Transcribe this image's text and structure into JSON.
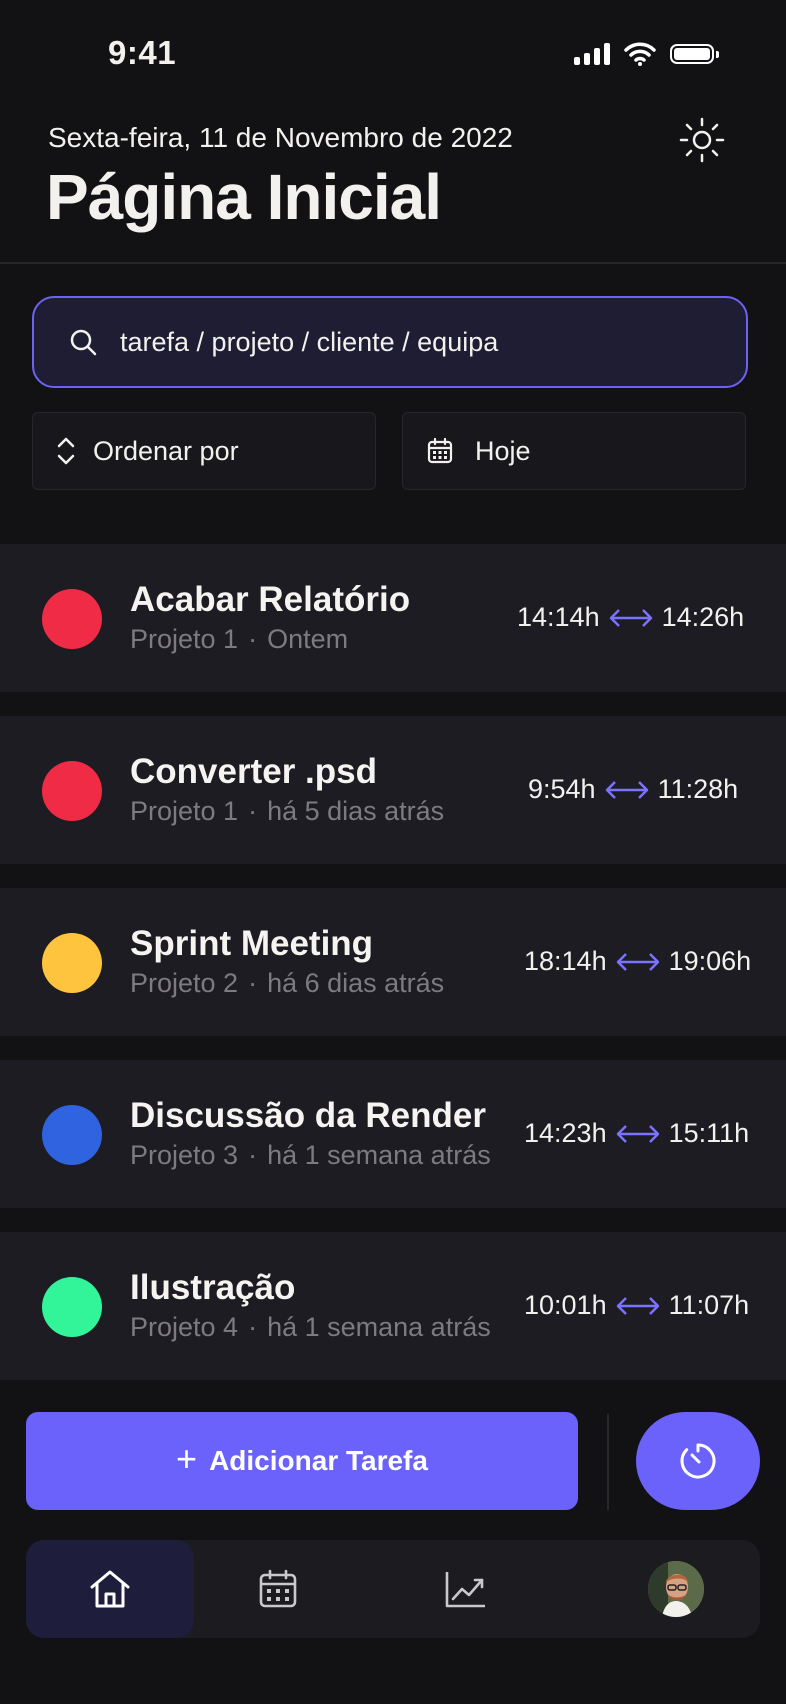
{
  "status_bar": {
    "time": "9:41"
  },
  "header": {
    "date": "Sexta-feira, 11 de Novembro de 2022",
    "title": "Página Inicial",
    "theme_icon": "sun-icon"
  },
  "search": {
    "value": "tarefa / projeto / cliente / equipa",
    "icon": "search-icon"
  },
  "filters": {
    "sort_label": "Ordenar por",
    "date_label": "Hoje"
  },
  "tasks": [
    {
      "name": "Acabar Relatório",
      "project": "Projeto 1",
      "when": "Ontem",
      "start": "14:14h",
      "end": "14:26h",
      "color": "#ef2b45"
    },
    {
      "name": "Converter .psd",
      "project": "Projeto 1",
      "when": "há 5 dias atrás",
      "start": "9:54h",
      "end": "11:28h",
      "color": "#ef2b45"
    },
    {
      "name": "Sprint Meeting",
      "project": "Projeto 2",
      "when": "há 6 dias atrás",
      "start": "18:14h",
      "end": "19:06h",
      "color": "#ffc43d"
    },
    {
      "name": "Discussão da Render",
      "project": "Projeto 3",
      "when": "há 1 semana atrás",
      "start": "14:23h",
      "end": "15:11h",
      "color": "#2f63e0"
    },
    {
      "name": "Ilustração",
      "project": "Projeto 4",
      "when": "há 1 semana atrás",
      "start": "10:01h",
      "end": "11:07h",
      "color": "#32f59a"
    }
  ],
  "actions": {
    "add_task_label": "Adicionar Tarefa",
    "timer_icon": "timer-icon"
  },
  "tabbar": {
    "items": [
      "home-icon",
      "calendar-icon",
      "chart-icon",
      "avatar"
    ],
    "active": "home-icon"
  },
  "colors": {
    "accent": "#6b62fb",
    "background": "#121214",
    "card": "#1c1c22"
  }
}
